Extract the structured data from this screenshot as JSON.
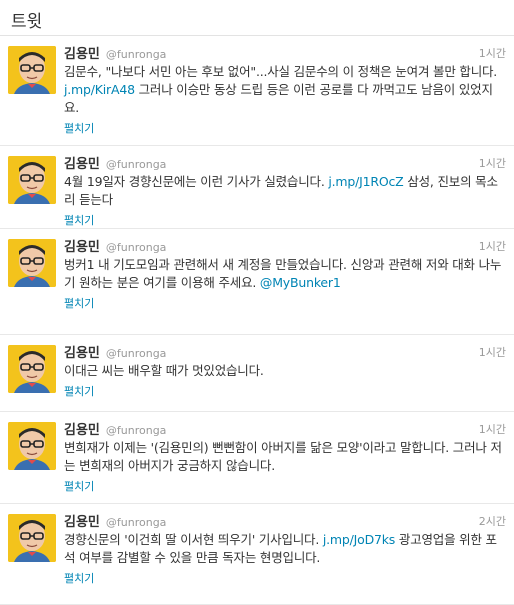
{
  "header": {
    "title": "트윗"
  },
  "tweets": [
    {
      "name": "김용민",
      "handle": "@funronga",
      "time": "1시간",
      "segments": [
        {
          "t": "text",
          "v": "김문수, \"나보다 서민 아는 후보 없어\"...사실 김문수의 이 정책은 눈여겨 볼만 합니다. "
        },
        {
          "t": "link",
          "v": "j.mp/KirA48"
        },
        {
          "t": "text",
          "v": " 그러나 이승만 동상 드립 등은 이런 공로를 다 까먹고도 남음이 있었지요."
        }
      ],
      "expand": "펼치기"
    },
    {
      "name": "김용민",
      "handle": "@funronga",
      "time": "1시간",
      "segments": [
        {
          "t": "text",
          "v": "4월 19일자 경향신문에는 이런 기사가 실렸습니다. "
        },
        {
          "t": "link",
          "v": "j.mp/J1ROcZ"
        },
        {
          "t": "text",
          "v": " 삼성, 진보의 목소리 듣는다"
        }
      ],
      "expand": "펼치기"
    },
    {
      "name": "김용민",
      "handle": "@funronga",
      "time": "1시간",
      "segments": [
        {
          "t": "text",
          "v": "벙커1 내 기도모임과 관련해서 새 계정을 만들었습니다. 신앙과 관련해 저와 대화 나누기 원하는 분은 여기를 이용해 주세요. "
        },
        {
          "t": "link",
          "v": "@MyBunker1"
        }
      ],
      "expand": "펼치기"
    },
    {
      "name": "김용민",
      "handle": "@funronga",
      "time": "1시간",
      "segments": [
        {
          "t": "text",
          "v": "이대근 씨는 배우할 때가 멋있었습니다."
        }
      ],
      "expand": "펼치기"
    },
    {
      "name": "김용민",
      "handle": "@funronga",
      "time": "1시간",
      "segments": [
        {
          "t": "text",
          "v": "변희재가 이제는 '(김용민의) 뻔뻔함이 아버지를 닮은 모양'이라고 말합니다. 그러나 저는 변희재의 아버지가 궁금하지 않습니다."
        }
      ],
      "expand": "펼치기"
    },
    {
      "name": "김용민",
      "handle": "@funronga",
      "time": "2시간",
      "segments": [
        {
          "t": "text",
          "v": "경향신문의 '이건희 딸 이서현 띄우기' 기사입니다. "
        },
        {
          "t": "link",
          "v": "j.mp/JoD7ks"
        },
        {
          "t": "text",
          "v": " 광고영업을 위한 포석 여부를 감별할 수 있을 만큼 독자는 현명입니다."
        }
      ],
      "expand": "펼치기"
    }
  ],
  "colors": {
    "link": "#0084b4",
    "avatar_bg": "#f3c31c",
    "meta": "#999999"
  },
  "icons": {
    "avatar": "profile-photo-avatar"
  }
}
